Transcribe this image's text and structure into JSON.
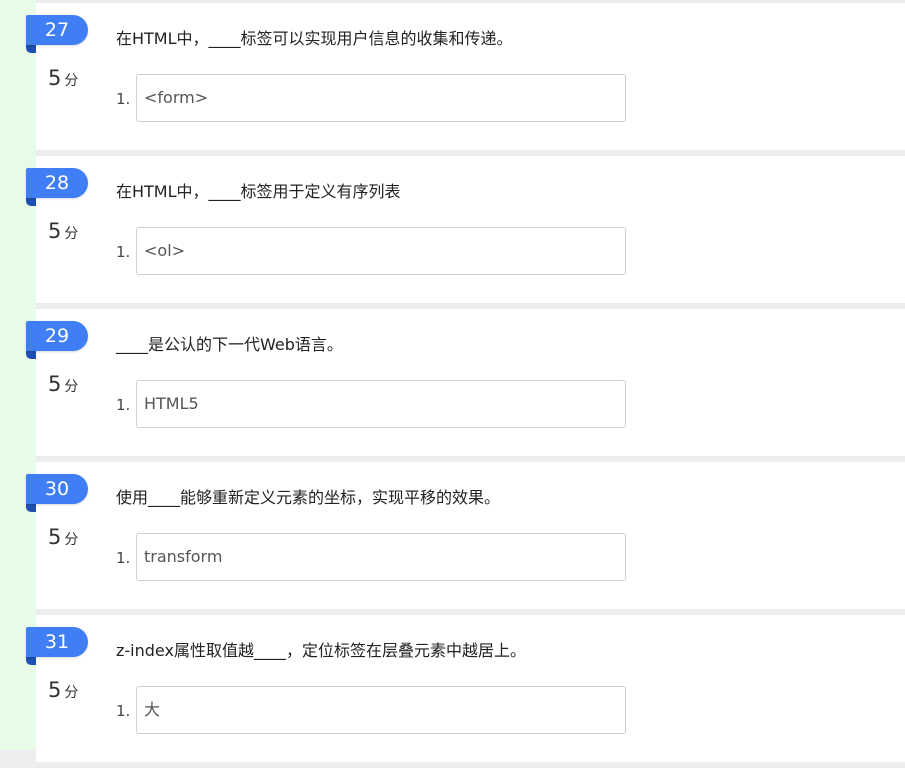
{
  "questions": [
    {
      "number": "27",
      "score": "5",
      "score_unit": "分",
      "text": "在HTML中，____标签可以实现用户信息的收集和传递。",
      "answers": [
        {
          "index": "1.",
          "value": "<form>"
        }
      ]
    },
    {
      "number": "28",
      "score": "5",
      "score_unit": "分",
      "text": "在HTML中，____标签用于定义有序列表",
      "answers": [
        {
          "index": "1.",
          "value": "<ol>"
        }
      ]
    },
    {
      "number": "29",
      "score": "5",
      "score_unit": "分",
      "text": "____是公认的下一代Web语言。",
      "answers": [
        {
          "index": "1.",
          "value": "HTML5"
        }
      ]
    },
    {
      "number": "30",
      "score": "5",
      "score_unit": "分",
      "text": "使用____能够重新定义元素的坐标，实现平移的效果。",
      "answers": [
        {
          "index": "1.",
          "value": "transform"
        }
      ]
    },
    {
      "number": "31",
      "score": "5",
      "score_unit": "分",
      "text": "z-index属性取值越____，定位标签在层叠元素中越居上。",
      "answers": [
        {
          "index": "1.",
          "value": "大"
        }
      ]
    }
  ],
  "colors": {
    "badge": "#3f7ef5",
    "badge_fold": "#1f4fb3",
    "left_strip": "#e8fbe8",
    "separator": "#ecedef"
  }
}
